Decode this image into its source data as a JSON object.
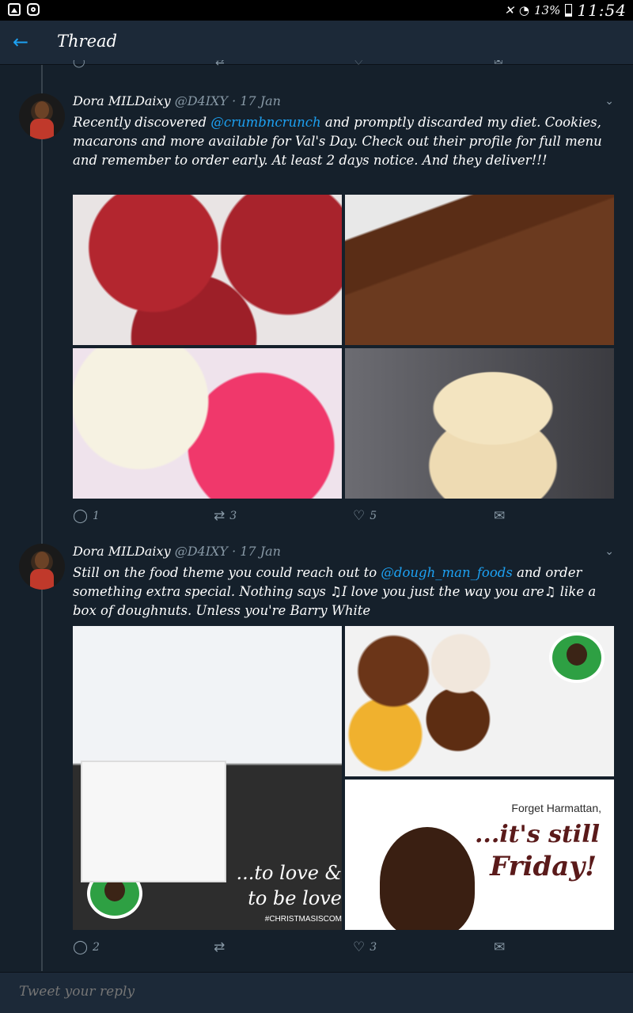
{
  "status_bar": {
    "battery": "13%",
    "time": "11:54"
  },
  "app_bar": {
    "title": "Thread"
  },
  "tweets": [
    {
      "name": "Dora MILDaixy",
      "meta": "@D4IXY · 17 Jan",
      "text_before": "Recently discovered ",
      "mention": "@crumbncrunch",
      "text_after": " and promptly discarded my diet. Cookies, macarons and more available for Val's Day. Check out their profile for full menu and remember to order early. At least 2 days notice.  And they deliver!!!",
      "images": [
        "red-velvet-cookies",
        "brownies-with-sprinkles",
        "pink-macarons",
        "stacked-cookies"
      ],
      "replies": "1",
      "retweets": "3",
      "likes": "5"
    },
    {
      "name": "Dora MILDaixy",
      "meta": "@D4IXY · 17 Jan",
      "text_before": "Still on the food theme you could reach out to ",
      "mention": "@dough_man_foods",
      "text_after": " and order something extra special. Nothing says ♫I love you just the way you are♫ like a box of doughnuts. Unless you're Barry White",
      "images": [
        "couple-with-doughnut-box",
        "doughnuts-in-box",
        "friday-doughnut-ad"
      ],
      "image_text": {
        "overlay_line1": "...to love &",
        "overlay_line2": "to be love",
        "overlay_tag": "#CHRISTMASISCOM",
        "ad_line1": "Forget Harmattan,",
        "ad_line2": "...it's still",
        "ad_line3": "Friday!"
      },
      "replies": "2",
      "retweets": "",
      "likes": "3"
    }
  ],
  "reply_bar": {
    "placeholder": "Tweet your reply"
  }
}
